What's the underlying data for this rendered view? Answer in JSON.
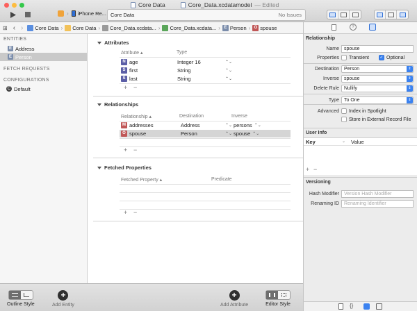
{
  "colors": {
    "accent": "#3b82f0",
    "close": "#fc605c",
    "minimize": "#fdbc40",
    "zoom": "#34c84a"
  },
  "titlebar": {
    "window_title": "Core Data",
    "document_title": "Core_Data.xcdatamodel",
    "edited_suffix": "— Edited",
    "scheme_target": "iPhone Re...",
    "activity_title": "Core Data",
    "activity_status": "No Issues"
  },
  "jumpbar": {
    "crumbs": [
      "Core Data",
      "Core Data",
      "Core_Data.xcdata...",
      "Core_Data.xcdata...",
      "Person",
      "spouse"
    ]
  },
  "sidebar": {
    "entities_header": "ENTITIES",
    "entities": [
      "Address",
      "Person"
    ],
    "fetch_requests_header": "FETCH REQUESTS",
    "configurations_header": "CONFIGURATIONS",
    "configurations": [
      "Default"
    ]
  },
  "attributes": {
    "title": "Attributes",
    "col_attribute": "Attribute",
    "col_type": "Type",
    "rows": [
      {
        "icon": "N",
        "name": "age",
        "type": "Integer 16"
      },
      {
        "icon": "S",
        "name": "first",
        "type": "String"
      },
      {
        "icon": "S",
        "name": "last",
        "type": "String"
      }
    ]
  },
  "relationships": {
    "title": "Relationships",
    "col_relationship": "Relationship",
    "col_destination": "Destination",
    "col_inverse": "Inverse",
    "rows": [
      {
        "icon": "M",
        "name": "addresses",
        "destination": "Address",
        "inverse": "persons"
      },
      {
        "icon": "O",
        "name": "spouse",
        "destination": "Person",
        "inverse": "spouse"
      }
    ]
  },
  "fetched": {
    "title": "Fetched Properties",
    "col_property": "Fetched Property",
    "col_predicate": "Predicate"
  },
  "bottombar": {
    "outline_style": "Outline Style",
    "add_entity": "Add Entity",
    "add_attribute": "Add Attribute",
    "editor_style": "Editor Style"
  },
  "inspector": {
    "relationship_title": "Relationship",
    "name_label": "Name",
    "name_value": "spouse",
    "properties_label": "Properties",
    "transient_label": "Transient",
    "optional_label": "Optional",
    "destination_label": "Destination",
    "destination_value": "Person",
    "inverse_label": "Inverse",
    "inverse_value": "spouse",
    "delete_rule_label": "Delete Rule",
    "delete_rule_value": "Nullify",
    "type_label": "Type",
    "type_value": "To One",
    "advanced_label": "Advanced",
    "index_spotlight_label": "Index in Spotlight",
    "store_external_label": "Store in External Record File",
    "user_info_title": "User Info",
    "key_header": "Key",
    "value_header": "Value",
    "versioning_title": "Versioning",
    "hash_modifier_label": "Hash Modifier",
    "hash_modifier_placeholder": "Version Hash Modifier",
    "renaming_id_label": "Renaming ID",
    "renaming_id_placeholder": "Renaming Identifier"
  }
}
